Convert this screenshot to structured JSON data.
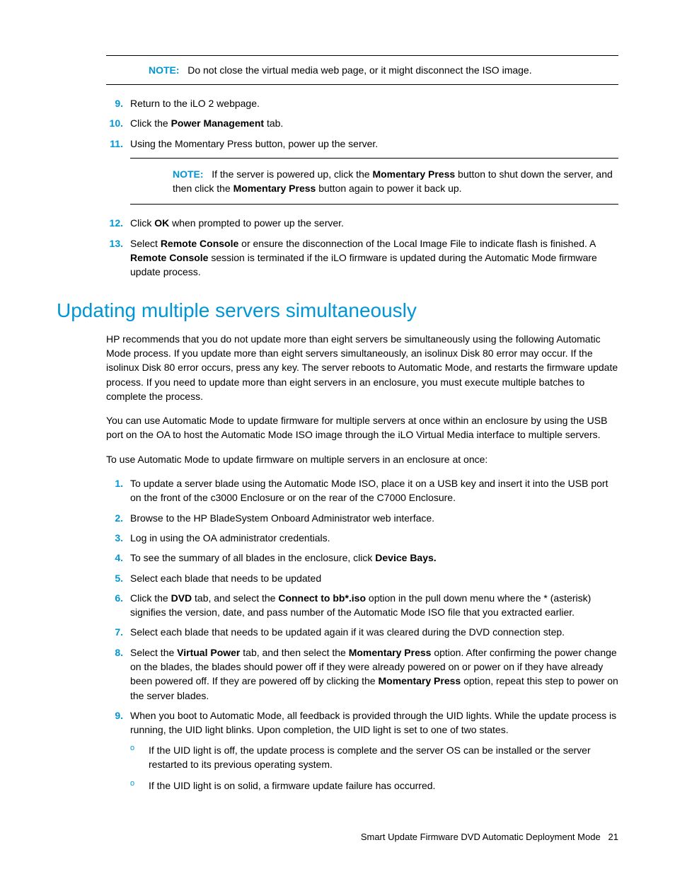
{
  "note1": {
    "label": "NOTE:",
    "text": "Do not close the virtual media web page, or it might disconnect the ISO image."
  },
  "steps_a": {
    "s9": {
      "num": "9.",
      "text": "Return to the iLO 2 webpage."
    },
    "s10": {
      "num": "10.",
      "pre": "Click the ",
      "bold": "Power Management",
      "post": " tab."
    },
    "s11": {
      "num": "11.",
      "text": "Using the Momentary Press button, power up the server."
    }
  },
  "note2": {
    "label": "NOTE:",
    "pre": "If the server is powered up, click the ",
    "b1": "Momentary Press",
    "mid": " button to shut down the server, and then click the ",
    "b2": "Momentary Press",
    "post": " button again to power it back up."
  },
  "steps_b": {
    "s12": {
      "num": "12.",
      "pre": "Click ",
      "bold": "OK",
      "post": " when prompted to power up the server."
    },
    "s13": {
      "num": "13.",
      "pre": "Select ",
      "b1": "Remote Console",
      "mid": " or ensure the disconnection of the Local Image File to indicate flash is finished. A ",
      "b2": "Remote Console",
      "post": " session is terminated if the iLO firmware is updated during the Automatic Mode firmware update process."
    }
  },
  "heading": "Updating multiple servers simultaneously",
  "para1": "HP recommends that you do not update  more than eight servers be simultaneously using the following Automatic Mode process. If you update more than eight servers simultaneously, an isolinux Disk 80 error may occur. If the isolinux Disk 80 error occurs, press any key. The server reboots to Automatic Mode, and restarts the firmware update process. If you need to update more than eight servers in an enclosure, you must execute multiple batches to complete the process.",
  "para2": "You can use Automatic Mode to update firmware for multiple servers at once within an enclosure by using the USB port on the OA to host the Automatic Mode ISO image through the iLO Virtual Media interface to multiple servers.",
  "para3": "To use Automatic Mode to update firmware on multiple servers in an enclosure at once:",
  "steps_c": {
    "s1": {
      "num": "1.",
      "text": "To update a server blade using the Automatic Mode ISO, place it on a USB key and insert it into the USB port on the front of the c3000 Enclosure or on the rear of the C7000 Enclosure."
    },
    "s2": {
      "num": "2.",
      "text": "Browse to the HP BladeSystem Onboard Administrator web interface."
    },
    "s3": {
      "num": "3.",
      "text": "Log in using the OA administrator credentials."
    },
    "s4": {
      "num": "4.",
      "pre": "To see the summary of all blades in the enclosure, click ",
      "bold": "Device Bays."
    },
    "s5": {
      "num": "5.",
      "text": "Select each blade that needs to be updated"
    },
    "s6": {
      "num": "6.",
      "pre": "Click the ",
      "b1": "DVD",
      "mid": " tab, and select the ",
      "b2": "Connect to bb*.iso",
      "post": " option in the pull down menu where the * (asterisk) signifies the version, date, and pass number of the Automatic Mode ISO file that you extracted earlier."
    },
    "s7": {
      "num": "7.",
      "text": "Select each blade that needs to be updated again if it was cleared during the DVD connection step."
    },
    "s8": {
      "num": "8.",
      "pre": "Select the ",
      "b1": "Virtual Power",
      "mid1": " tab, and then select the ",
      "b2": "Momentary Press",
      "mid2": " option. After confirming the power change on the blades, the blades should power off if they were already powered on or power on if they have already been powered off. If they are powered off by clicking the ",
      "b3": "Momentary Press",
      "post": " option, repeat this step to power on the server blades."
    },
    "s9": {
      "num": "9.",
      "text": "When you boot to Automatic Mode, all feedback is provided through the UID lights. While the update process is running, the UID light blinks. Upon completion, the UID light is set to one of two states."
    }
  },
  "sublist": {
    "a": "If the UID light is off, the update process is complete and the server OS can be installed or the server restarted to its previous operating system.",
    "b": "If the UID light is on solid, a firmware update failure has occurred."
  },
  "footer": {
    "title": "Smart Update Firmware DVD Automatic Deployment Mode",
    "page": "21"
  }
}
